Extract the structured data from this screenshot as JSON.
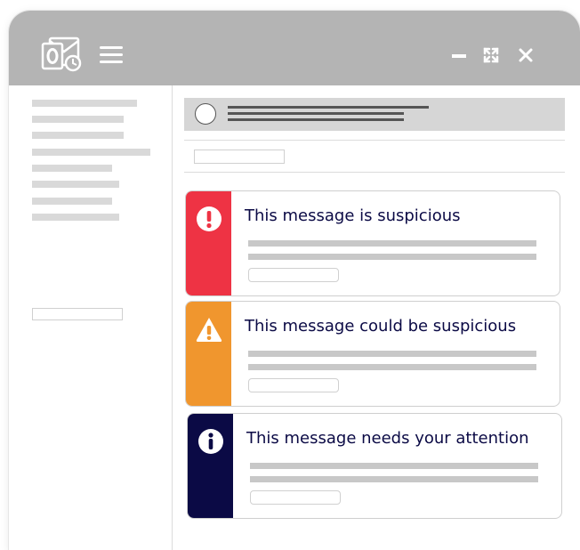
{
  "window": {
    "icon": "outlook-mail-clock-icon",
    "controls": [
      "minimize-icon",
      "maximize-icon",
      "close-icon"
    ]
  },
  "alerts": [
    {
      "title": "This message is suspicious",
      "icon": "exclamation-circle-icon",
      "color": "#ee3344"
    },
    {
      "title": "This message could be suspicious",
      "icon": "warning-triangle-icon",
      "color": "#f0962e"
    },
    {
      "title": "This message needs your attention",
      "icon": "info-circle-icon",
      "color": "#0b0a45"
    }
  ],
  "colors": {
    "titlebar": "#b4b4b4",
    "alert_title_text": "#0b0a45"
  }
}
